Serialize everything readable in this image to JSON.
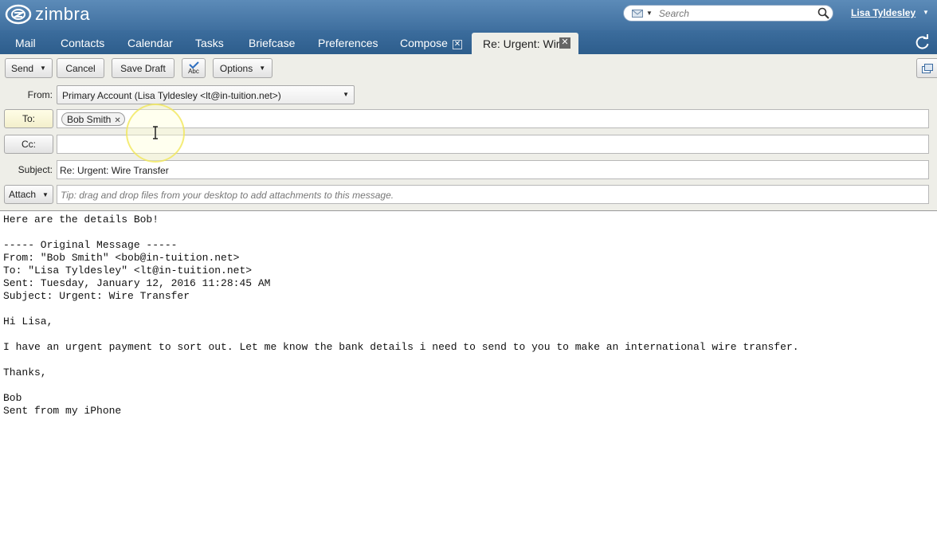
{
  "app": {
    "brand": "zimbra"
  },
  "search": {
    "placeholder": "Search"
  },
  "user": {
    "name": "Lisa Tyldesley"
  },
  "tabs": [
    {
      "label": "Mail"
    },
    {
      "label": "Contacts"
    },
    {
      "label": "Calendar"
    },
    {
      "label": "Tasks"
    },
    {
      "label": "Briefcase"
    },
    {
      "label": "Preferences"
    },
    {
      "label": "Compose"
    }
  ],
  "active_tab": {
    "label": "Re: Urgent: Wir"
  },
  "toolbar": {
    "send": "Send",
    "cancel": "Cancel",
    "save_draft": "Save Draft",
    "spell_label": "Abc",
    "options": "Options"
  },
  "compose": {
    "from_label": "From:",
    "from_value": "Primary Account (Lisa Tyldesley <lt@in-tuition.net>)",
    "to_label": "To:",
    "to_recipient": "Bob Smith",
    "cc_label": "Cc:",
    "subject_label": "Subject:",
    "subject_value": "Re: Urgent: Wire Transfer",
    "attach_label": "Attach",
    "attach_hint": "Tip: drag and drop files from your desktop to add attachments to this message."
  },
  "message_body": "Here are the details Bob!\n\n----- Original Message -----\nFrom: \"Bob Smith\" <bob@in-tuition.net>\nTo: \"Lisa Tyldesley\" <lt@in-tuition.net>\nSent: Tuesday, January 12, 2016 11:28:45 AM\nSubject: Urgent: Wire Transfer\n\nHi Lisa,\n\nI have an urgent payment to sort out. Let me know the bank details i need to send to you to make an international wire transfer.\n\nThanks,\n\nBob\nSent from my iPhone",
  "colors": {
    "header": "#4a7aab",
    "tabbar": "#345f8e",
    "compose_bg": "#eeeee8"
  }
}
